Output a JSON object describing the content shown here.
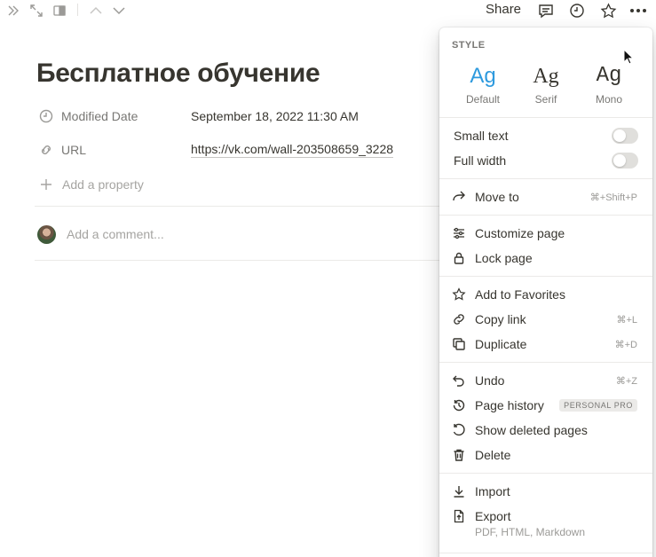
{
  "topbar": {
    "share_label": "Share",
    "icons": [
      "sidebar-expand-icon",
      "fullscreen-icon",
      "panel-icon",
      "chevron-up-icon",
      "chevron-down-icon",
      "comment-icon",
      "clock-icon",
      "star-icon",
      "more-icon"
    ]
  },
  "page": {
    "title": "Бесплатное обучение",
    "properties": [
      {
        "name": "Modified Date",
        "value": "September 18, 2022 11:30 AM",
        "icon": "clock-icon"
      },
      {
        "name": "URL",
        "value": "https://vk.com/wall-203508659_3228",
        "icon": "link-icon"
      }
    ],
    "add_property": "Add a property",
    "comment_placeholder": "Add a comment..."
  },
  "menu": {
    "style_label": "STYLE",
    "fonts": [
      {
        "sample": "Ag",
        "name": "Default",
        "selected": true
      },
      {
        "sample": "Ag",
        "name": "Serif",
        "selected": false
      },
      {
        "sample": "Ag",
        "name": "Mono",
        "selected": false
      }
    ],
    "small_text": "Small text",
    "full_width": "Full width",
    "move_to": {
      "label": "Move to",
      "shortcut": "⌘+Shift+P"
    },
    "customize_page": "Customize page",
    "lock_page": "Lock page",
    "add_to_favorites": "Add to Favorites",
    "copy_link": {
      "label": "Copy link",
      "shortcut": "⌘+L"
    },
    "duplicate": {
      "label": "Duplicate",
      "shortcut": "⌘+D"
    },
    "undo": {
      "label": "Undo",
      "shortcut": "⌘+Z"
    },
    "page_history": {
      "label": "Page history",
      "badge": "PERSONAL PRO"
    },
    "show_deleted": "Show deleted pages",
    "delete": "Delete",
    "import": "Import",
    "export": {
      "label": "Export",
      "sub": "PDF, HTML, Markdown"
    }
  },
  "colors": {
    "accent": "#2e9ade",
    "text": "#37352f",
    "muted": "#787774"
  }
}
